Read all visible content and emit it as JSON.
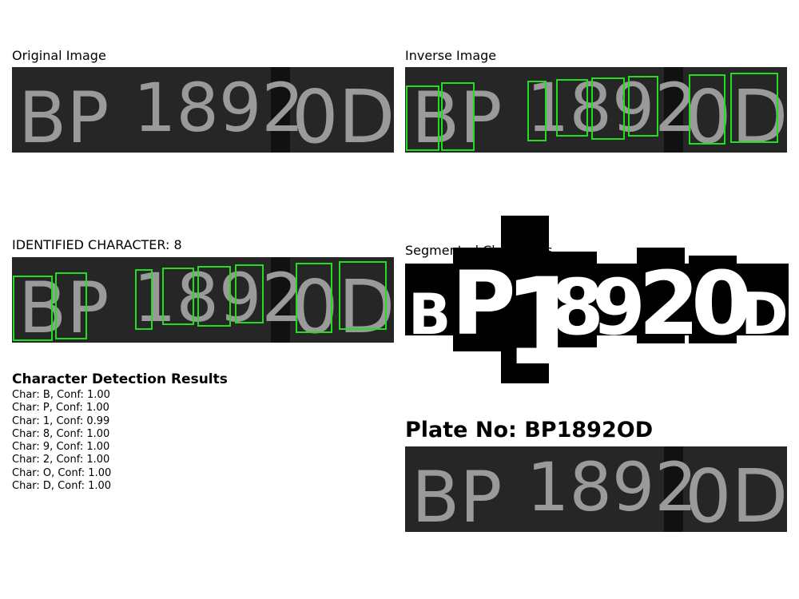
{
  "panels": {
    "original_title": "Original Image",
    "inverse_title": "Inverse Image",
    "identified_title": "IDENTIFIED CHARACTER: 8",
    "segmented_title": "Segmented Characters"
  },
  "plate": {
    "title": "Plate No: BP1892OD",
    "printed_text": [
      "BP",
      "1892",
      "0D"
    ]
  },
  "segmented_glyphs": [
    "B",
    "P",
    "1",
    "8",
    "9",
    "2",
    "0",
    "D"
  ],
  "results": {
    "title": "Character Detection Results",
    "items": [
      "Char: B, Conf: 1.00",
      "Char: P, Conf: 1.00",
      "Char: 1, Conf: 0.99",
      "Char: 8, Conf: 1.00",
      "Char: 9, Conf: 1.00",
      "Char: 2, Conf: 1.00",
      "Char: O, Conf: 1.00",
      "Char: D, Conf: 1.00"
    ]
  },
  "colors": {
    "plate_bg": "#262626",
    "plate_text": "#9a9a9a",
    "box": "#22dd22"
  }
}
